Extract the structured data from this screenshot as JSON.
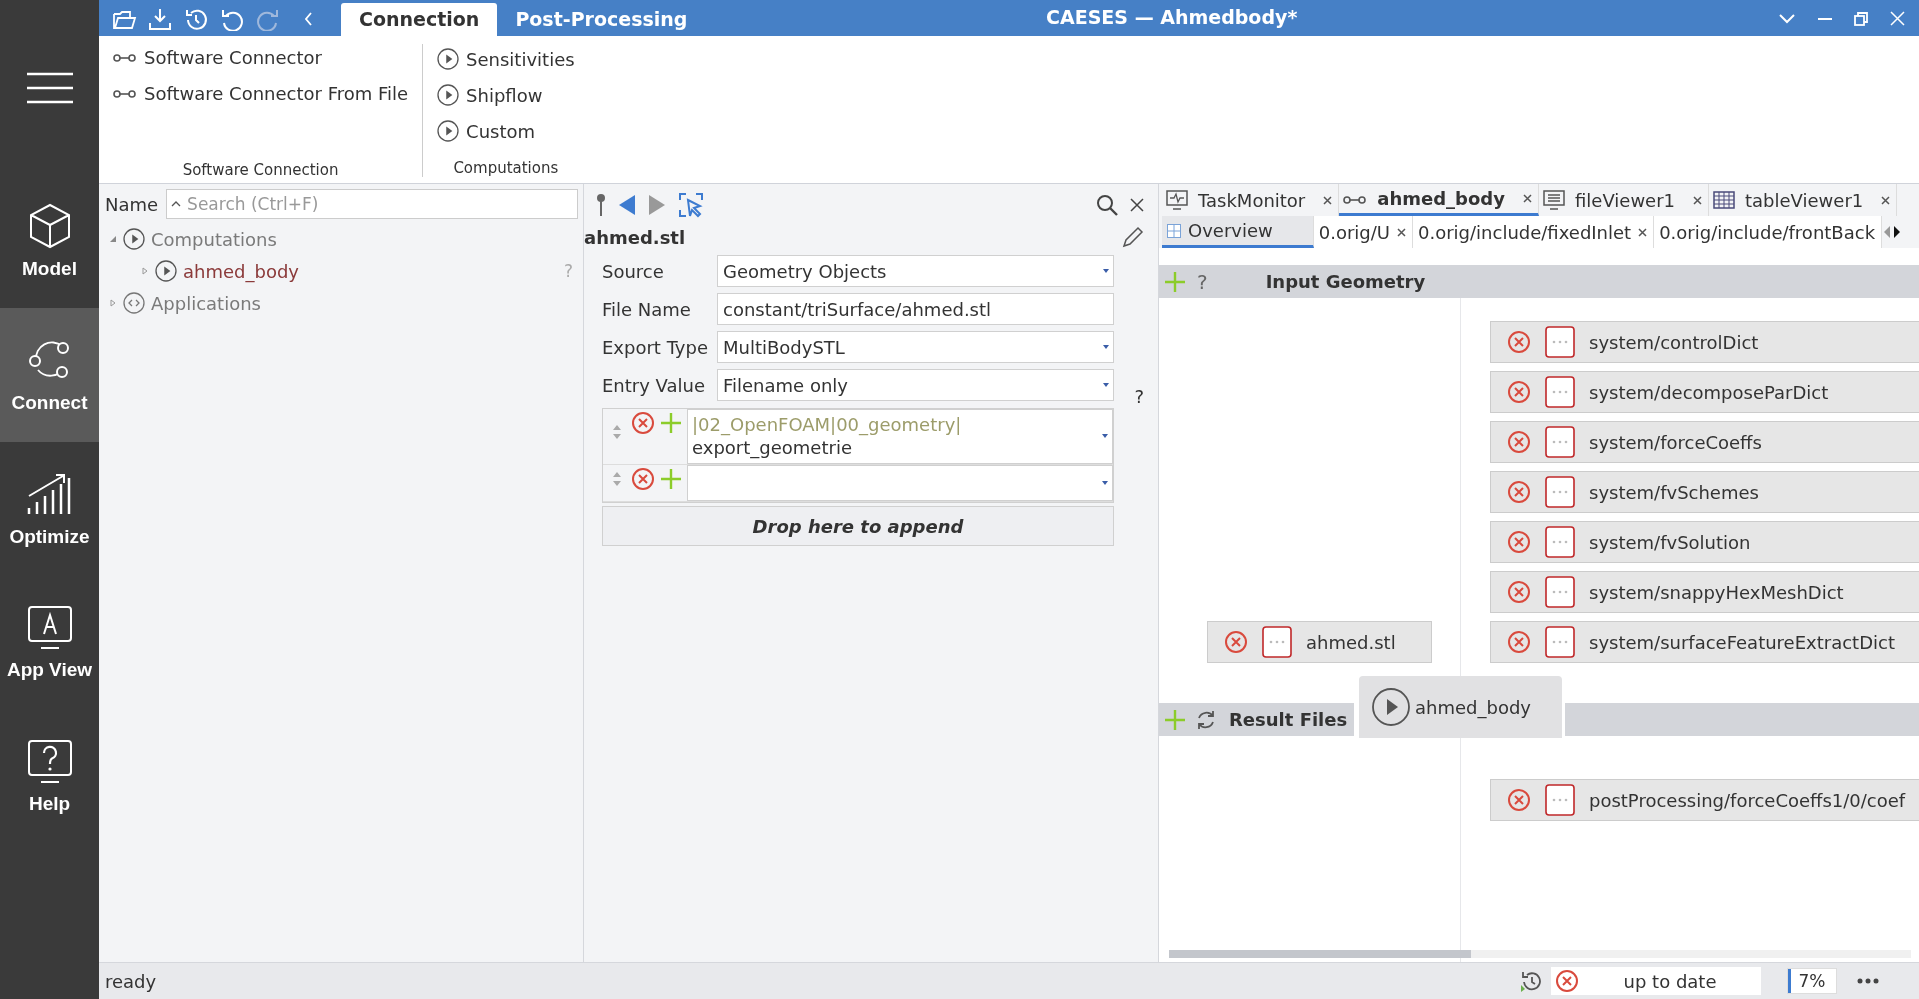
{
  "window": {
    "title": "CAESES — Ahmedbody*"
  },
  "sidebar": {
    "items": [
      {
        "label": "Model",
        "kind": "model",
        "selected": false
      },
      {
        "label": "Connect",
        "kind": "connect",
        "selected": true
      },
      {
        "label": "Optimize",
        "kind": "optimize",
        "selected": false
      },
      {
        "label": "App View",
        "kind": "appview",
        "selected": false
      },
      {
        "label": "Help",
        "kind": "help",
        "selected": false
      }
    ]
  },
  "quick_access": [
    {
      "kind": "open",
      "disabled": false
    },
    {
      "kind": "save",
      "disabled": false
    },
    {
      "kind": "history",
      "disabled": false
    },
    {
      "kind": "undo",
      "disabled": false
    },
    {
      "kind": "redo",
      "disabled": true
    },
    {
      "kind": "collapse",
      "disabled": false
    }
  ],
  "ribbon_tabs": [
    {
      "label": "Connection",
      "selected": true
    },
    {
      "label": "Post-Processing",
      "selected": false
    }
  ],
  "ribbon_groups": [
    {
      "title": "Software Connection",
      "items": [
        {
          "label": "Software Connector",
          "kind": "connector"
        },
        {
          "label": "Software Connector From File",
          "kind": "connector"
        }
      ]
    },
    {
      "title": "Computations",
      "items": [
        {
          "label": "Sensitivities",
          "kind": "run"
        },
        {
          "label": "Shipflow",
          "kind": "run"
        },
        {
          "label": "Custom",
          "kind": "run"
        }
      ]
    }
  ],
  "tree": {
    "header": "Name",
    "search": {
      "placeholder": "Search (Ctrl+F)"
    },
    "items": [
      {
        "label": "Computations",
        "kind": "run",
        "expanded": true,
        "color": "#7a7a7a",
        "children": [
          {
            "label": "ahmed_body",
            "kind": "run",
            "expanded": false,
            "color": "#8b3a3a",
            "hint": "?"
          }
        ]
      },
      {
        "label": "Applications",
        "kind": "app",
        "expanded": false,
        "color": "#7a7a7a"
      }
    ]
  },
  "properties": {
    "title": "ahmed.stl",
    "help": "?",
    "fields": [
      {
        "label": "Source",
        "value": "Geometry Objects",
        "kind": "dropdown"
      },
      {
        "label": "File Name",
        "value": "constant/triSurface/ahmed.stl",
        "kind": "text"
      },
      {
        "label": "Export Type",
        "value": "MultiBodySTL",
        "kind": "dropdown"
      },
      {
        "label": "Entry Value",
        "value": "Filename only",
        "kind": "dropdown"
      }
    ],
    "entries": [
      {
        "kind": "filled",
        "path": "|02_OpenFOAM|00_geometry|",
        "name": "export_geometrie"
      },
      {
        "kind": "empty"
      }
    ],
    "drop_label": "Drop here to append"
  },
  "editor_tabs": [
    {
      "label": "TaskMonitor",
      "kind": "monitor",
      "selected": false
    },
    {
      "label": "ahmed_body",
      "kind": "connector",
      "selected": true
    },
    {
      "label": "fileViewer1",
      "kind": "file",
      "selected": false
    },
    {
      "label": "tableViewer1",
      "kind": "table",
      "selected": false
    }
  ],
  "sub_tabs": [
    {
      "label": "Overview",
      "selected": true
    },
    {
      "label": "0.orig/U",
      "selected": false
    },
    {
      "label": "0.orig/include/fixedInlet",
      "selected": false
    },
    {
      "label": "0.orig/include/frontBack",
      "selected": false
    }
  ],
  "canvas": {
    "input_section": {
      "title": "Input Geometry",
      "help": "?"
    },
    "input_files": [
      {
        "label": "ahmed.stl"
      }
    ],
    "template_files": [
      {
        "label": "system/controlDict"
      },
      {
        "label": "system/decomposeParDict"
      },
      {
        "label": "system/forceCoeffs"
      },
      {
        "label": "system/fvSchemes"
      },
      {
        "label": "system/fvSolution"
      },
      {
        "label": "system/snappyHexMeshDict"
      },
      {
        "label": "system/surfaceFeatureExtractDict"
      }
    ],
    "computation": {
      "label": "ahmed_body"
    },
    "result_section": {
      "title": "Result Files"
    },
    "result_files": [
      {
        "label": "postProcessing/forceCoeffs1/0/coef"
      }
    ]
  },
  "status_bar": {
    "message": "ready",
    "state": "up to date",
    "progress": {
      "label": "7%",
      "level": 0.07
    }
  }
}
